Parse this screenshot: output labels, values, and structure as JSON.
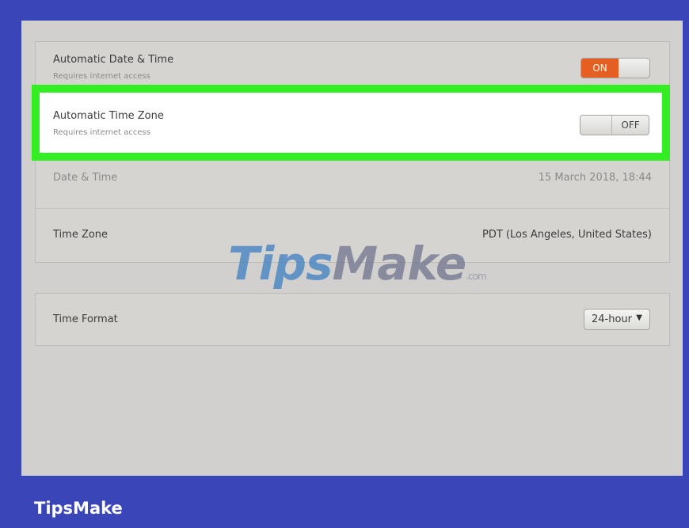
{
  "settings": {
    "auto_date_time": {
      "title": "Automatic Date & Time",
      "subtitle": "Requires internet access",
      "toggle_on": "ON"
    },
    "auto_time_zone": {
      "title": "Automatic Time Zone",
      "subtitle": "Requires internet access",
      "toggle_off": "OFF"
    },
    "date_time": {
      "label": "Date & Time",
      "value": "15 March 2018, 18:44"
    },
    "time_zone": {
      "label": "Time Zone",
      "value": "PDT (Los Angeles, United States)"
    },
    "time_format": {
      "label": "Time Format",
      "selected": "24-hour"
    }
  },
  "watermark": {
    "part1": "Tips",
    "part2": "Make",
    "suffix": ".com"
  },
  "brand": {
    "text": "TipsMake"
  },
  "colors": {
    "background": "#3a45b8",
    "highlight": "#33ee22",
    "toggle_on": "#e55e22"
  },
  "icons": {
    "dropdown": "triangle-down"
  }
}
